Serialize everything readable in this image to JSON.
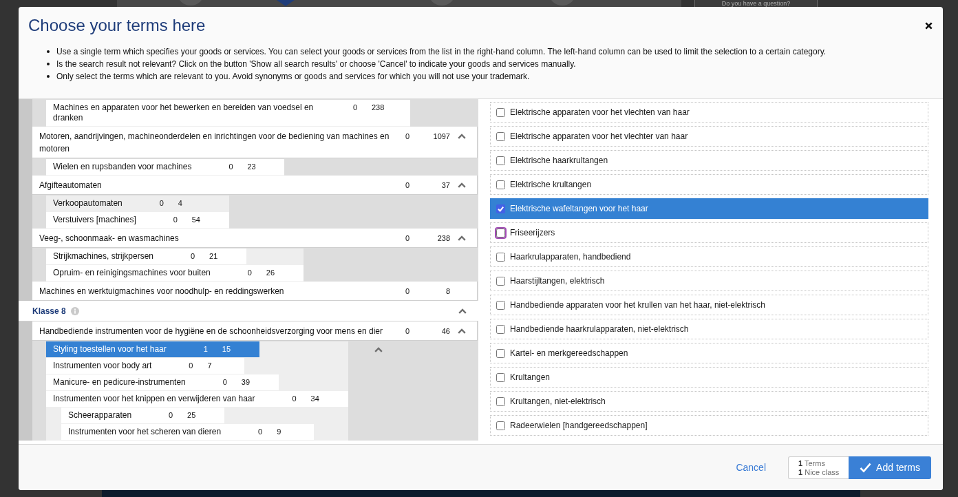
{
  "backdrop": {
    "help_button": "Do you have a question?"
  },
  "dialog": {
    "title": "Choose your terms here",
    "instructions": [
      "Use a single term which specifies your goods or services. You can select your goods or services from the list in the right-hand column. The left-hand column can be used to limit the selection to a certain category.",
      "Is the search result not relevant? Click on the button 'Show all search results' or choose 'Cancel' to indicate your goods and services manually.",
      "Only select the terms which are relevant to you. Avoid synonyms or goods and services for which you will not use your trademark."
    ],
    "categories": [
      {
        "items": [
          {
            "children": [
              {
                "label": "Machines en apparaten voor het bewerken en bereiden van voedsel en dranken",
                "selected_count": "0",
                "total": "238",
                "selected": false,
                "hovered": false,
                "expanded": false
              }
            ]
          },
          {
            "label": "Motoren, aandrijvingen, machineonderdelen en inrichtingen voor de bediening van machines en motoren",
            "selected_count": "0",
            "total": "1097",
            "expanded": true,
            "children": [
              {
                "label": "Wielen en rupsbanden voor machines",
                "selected_count": "0",
                "total": "23",
                "selected": false,
                "hovered": false,
                "expanded": false
              }
            ]
          },
          {
            "label": "Afgifteautomaten",
            "selected_count": "0",
            "total": "37",
            "expanded": true,
            "children": [
              {
                "label": "Verkoopautomaten",
                "selected_count": "0",
                "total": "4",
                "selected": false,
                "hovered": true,
                "expanded": false
              },
              {
                "label": "Verstuivers [machines]",
                "selected_count": "0",
                "total": "54",
                "selected": false,
                "hovered": false,
                "expanded": false
              }
            ]
          },
          {
            "label": "Veeg-, schoonmaak- en wasmachines",
            "selected_count": "0",
            "total": "238",
            "expanded": true,
            "children": [
              {
                "label": "Strijkmachines, strijkpersen",
                "selected_count": "0",
                "total": "21",
                "selected": false,
                "hovered": false,
                "expanded": false
              },
              {
                "label": "Opruim- en reinigingsmachines voor buiten",
                "selected_count": "0",
                "total": "26",
                "selected": false,
                "hovered": false,
                "expanded": false
              }
            ]
          },
          {
            "label": "Machines en werktuigmachines voor noodhulp- en reddingswerken",
            "selected_count": "0",
            "total": "8",
            "expanded": false
          }
        ]
      },
      {
        "heading": "Klasse 8",
        "expanded": true,
        "items": [
          {
            "label": "Handbediende instrumenten voor de hygiëne en de schoonheidsverzorging voor mens en dier",
            "selected_count": "0",
            "total": "46",
            "expanded": true,
            "children": [
              {
                "label": "Styling toestellen voor het haar",
                "selected_count": "1",
                "total": "15",
                "selected": true,
                "hovered": false,
                "expanded": true
              },
              {
                "label": "Instrumenten voor body art",
                "selected_count": "0",
                "total": "7",
                "selected": false,
                "hovered": false,
                "expanded": false
              },
              {
                "label": "Manicure- en pedicure-instrumenten",
                "selected_count": "0",
                "total": "39",
                "selected": false,
                "hovered": false,
                "expanded": false
              },
              {
                "label": "Instrumenten voor het knippen en verwijderen van haar",
                "selected_count": "0",
                "total": "34",
                "selected": false,
                "hovered": false,
                "expanded": false,
                "children": [
                  {
                    "label": "Scheerapparaten",
                    "selected_count": "0",
                    "total": "25",
                    "selected": false,
                    "hovered": false
                  },
                  {
                    "label": "Instrumenten voor het scheren van dieren",
                    "selected_count": "0",
                    "total": "9",
                    "selected": false,
                    "hovered": false
                  }
                ]
              }
            ]
          }
        ]
      }
    ],
    "terms": [
      {
        "label": "Elektrische apparaten voor het vlechten van haar",
        "checked": false,
        "focused": false
      },
      {
        "label": "Elektrische apparaten voor het vlechter van haar",
        "checked": false,
        "focused": false
      },
      {
        "label": "Elektrische haarkrultangen",
        "checked": false,
        "focused": false
      },
      {
        "label": "Elektrische krultangen",
        "checked": false,
        "focused": false
      },
      {
        "label": "Elektrische wafeltangen voor het haar",
        "checked": true,
        "focused": false
      },
      {
        "label": "Friseerijzers",
        "checked": false,
        "focused": true
      },
      {
        "label": "Haarkrulapparaten, handbediend",
        "checked": false,
        "focused": false
      },
      {
        "label": "Haarstijltangen, elektrisch",
        "checked": false,
        "focused": false
      },
      {
        "label": "Handbediende apparaten voor het krullen van het haar, niet-elektrisch",
        "checked": false,
        "focused": false
      },
      {
        "label": "Handbediende haarkrulapparaten, niet-elektrisch",
        "checked": false,
        "focused": false
      },
      {
        "label": "Kartel- en merkgereedschappen",
        "checked": false,
        "focused": false
      },
      {
        "label": "Krultangen",
        "checked": false,
        "focused": false
      },
      {
        "label": "Krultangen, niet-elektrisch",
        "checked": false,
        "focused": false
      },
      {
        "label": "Radeerwielen [handgereedschappen]",
        "checked": false,
        "focused": false
      }
    ],
    "footer": {
      "cancel": "Cancel",
      "summary": [
        "**1** Terms",
        "**1** Nice class"
      ],
      "add_button": "Add terms"
    }
  }
}
